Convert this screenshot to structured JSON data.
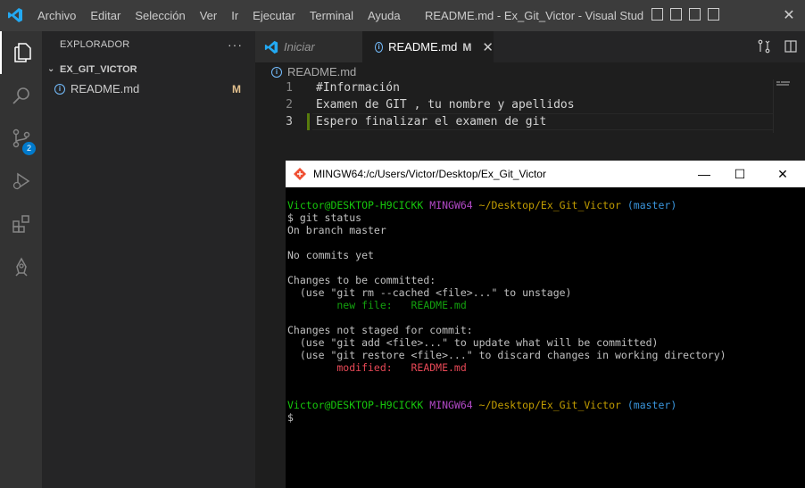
{
  "window": {
    "title": "README.md - Ex_Git_Victor - Visual Studio C...",
    "menu": [
      "Archivo",
      "Editar",
      "Selección",
      "Ver",
      "Ir",
      "Ejecutar",
      "Terminal",
      "Ayuda"
    ]
  },
  "activity_bar": {
    "scm_badge": "2"
  },
  "sidebar": {
    "header": "EXPLORADOR",
    "more": "···",
    "folder": "EX_GIT_VICTOR",
    "files": [
      {
        "name": "README.md",
        "status": "M"
      }
    ]
  },
  "editor": {
    "tabs": [
      {
        "label": "Iniciar",
        "preview": true
      },
      {
        "label": "README.md",
        "status": "M",
        "close": "✕",
        "active": true
      }
    ],
    "breadcrumb": "README.md",
    "lines": [
      {
        "num": "1",
        "text": "#Información"
      },
      {
        "num": "2",
        "text": "Examen de GIT , tu nombre y apellidos"
      },
      {
        "num": "3",
        "text": "Espero finalizar el examen de git"
      }
    ]
  },
  "terminal": {
    "title": "MINGW64:/c/Users/Victor/Desktop/Ex_Git_Victor",
    "controls": {
      "minimize": "—",
      "maximize": "☐",
      "close": "✕"
    },
    "prompt1": {
      "user": "Victor@DESKTOP-H9CICKK",
      "env": "MINGW64",
      "path": "~/Desktop/Ex_Git_Victor",
      "branch": "(master)"
    },
    "command": "$ git status",
    "out": {
      "branch": "On branch master",
      "no_commits": "No commits yet",
      "to_commit": "Changes to be committed:",
      "unstage_hint": "  (use \"git rm --cached <file>...\" to unstage)",
      "new_file": "        new file:   README.md",
      "not_staged": "Changes not staged for commit:",
      "add_hint": "  (use \"git add <file>...\" to update what will be committed)",
      "restore_hint": "  (use \"git restore <file>...\" to discard changes in working directory)",
      "modified": "        modified:   README.md"
    },
    "prompt2": {
      "user": "Victor@DESKTOP-H9CICKK",
      "env": "MINGW64",
      "path": "~/Desktop/Ex_Git_Victor",
      "branch": "(master)"
    },
    "cursor": "$",
    "colors": {
      "user": "#16c60c",
      "env": "#b148c6",
      "path": "#c19c00",
      "branch": "#3a96dd",
      "added": "#13a10e",
      "modified": "#e74856"
    }
  }
}
